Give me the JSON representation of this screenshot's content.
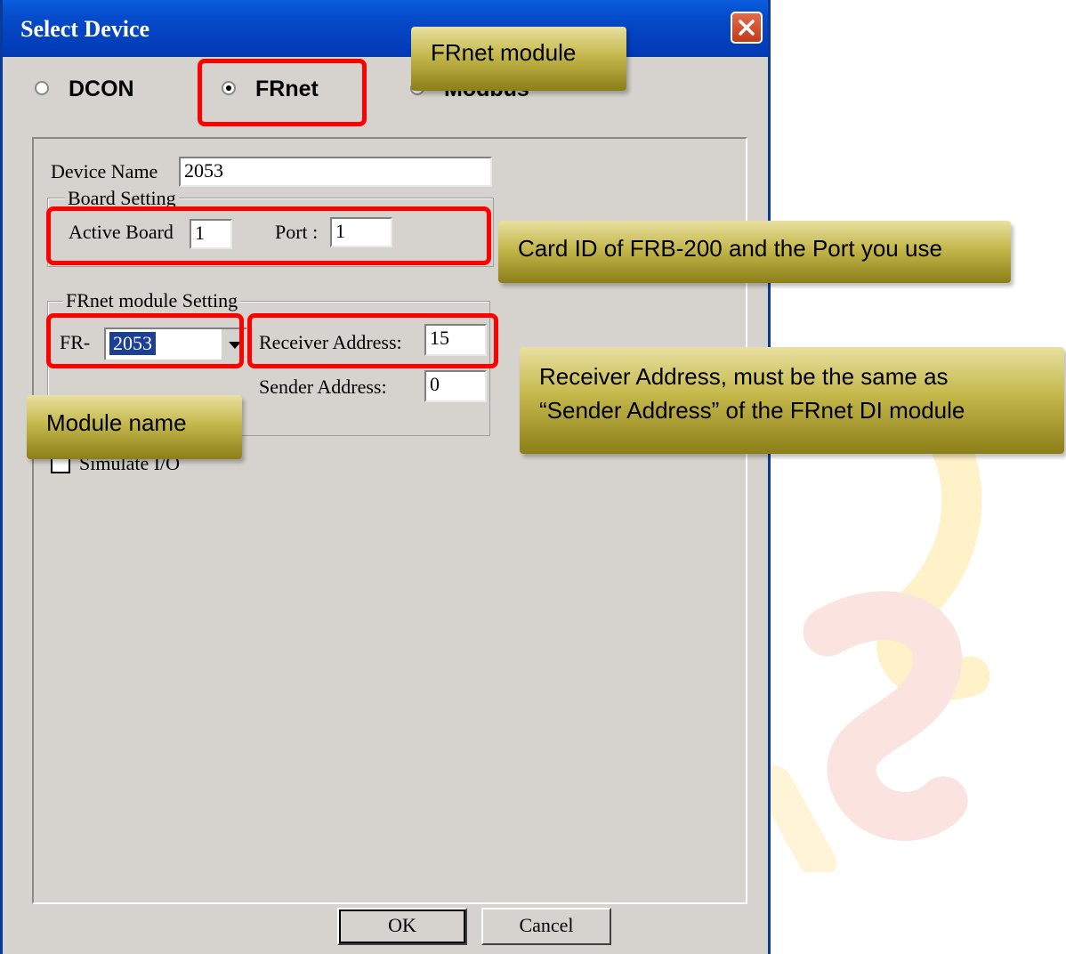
{
  "dialog": {
    "title": "Select Device",
    "protocols": [
      "DCON",
      "FRnet",
      "Modbus"
    ],
    "selected_protocol": "FRnet",
    "device_name_label": "Device Name",
    "device_name_value": "2053",
    "board_group_title": "Board Setting",
    "active_board_label": "Active  Board",
    "active_board_value": "1",
    "port_label": "Port :",
    "port_value": "1",
    "frnet_group_title": "FRnet module Setting",
    "fr_prefix": "FR-",
    "module_value": "2053",
    "receiver_label": "Receiver Address:",
    "receiver_value": "15",
    "sender_label": "Sender Address:",
    "sender_value": "0",
    "simulate_label": "Simulate I/O",
    "ok_label": "OK",
    "cancel_label": "Cancel"
  },
  "annotations": {
    "frnet_module": "FRnet module",
    "card_id": "Card ID of FRB-200 and the Port you use",
    "receiver_note_1": "Receiver Address, must be the same as",
    "receiver_note_2": "“Sender Address” of the FRnet DI module",
    "module_name": "Module name"
  },
  "colors": {
    "highlight": "#ff0000",
    "callout": "#c4b84c",
    "titlebar": "#0449c8"
  }
}
